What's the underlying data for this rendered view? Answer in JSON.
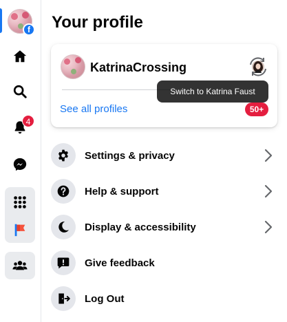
{
  "rail": {
    "notifications_count": "4",
    "items": [
      {
        "name": "home",
        "icon": "home-icon"
      },
      {
        "name": "search",
        "icon": "search-icon"
      },
      {
        "name": "notifications",
        "icon": "bell-icon"
      },
      {
        "name": "messenger",
        "icon": "messenger-icon"
      },
      {
        "name": "menu",
        "icon": "grid-menu-icon"
      },
      {
        "name": "pages",
        "icon": "flag-icon"
      },
      {
        "name": "groups",
        "icon": "groups-icon"
      }
    ],
    "active_color": "#1877f2"
  },
  "main": {
    "title": "Your profile"
  },
  "profile_card": {
    "name": "KatrinaCrossing",
    "see_all_label": "See all profiles",
    "profiles_count": "50+"
  },
  "tooltip": {
    "text": "Switch to Katrina Faust"
  },
  "menu": {
    "items": [
      {
        "label": "Settings & privacy",
        "icon": "gear-icon",
        "has_chevron": true
      },
      {
        "label": "Help & support",
        "icon": "question-icon",
        "has_chevron": true
      },
      {
        "label": "Display & accessibility",
        "icon": "moon-icon",
        "has_chevron": true
      },
      {
        "label": "Give feedback",
        "icon": "feedback-icon",
        "has_chevron": false
      },
      {
        "label": "Log Out",
        "icon": "logout-icon",
        "has_chevron": false
      }
    ]
  },
  "colors": {
    "brand_blue": "#1877f2",
    "badge_red": "#e41e3f",
    "icon_bg": "#e4e6eb"
  }
}
